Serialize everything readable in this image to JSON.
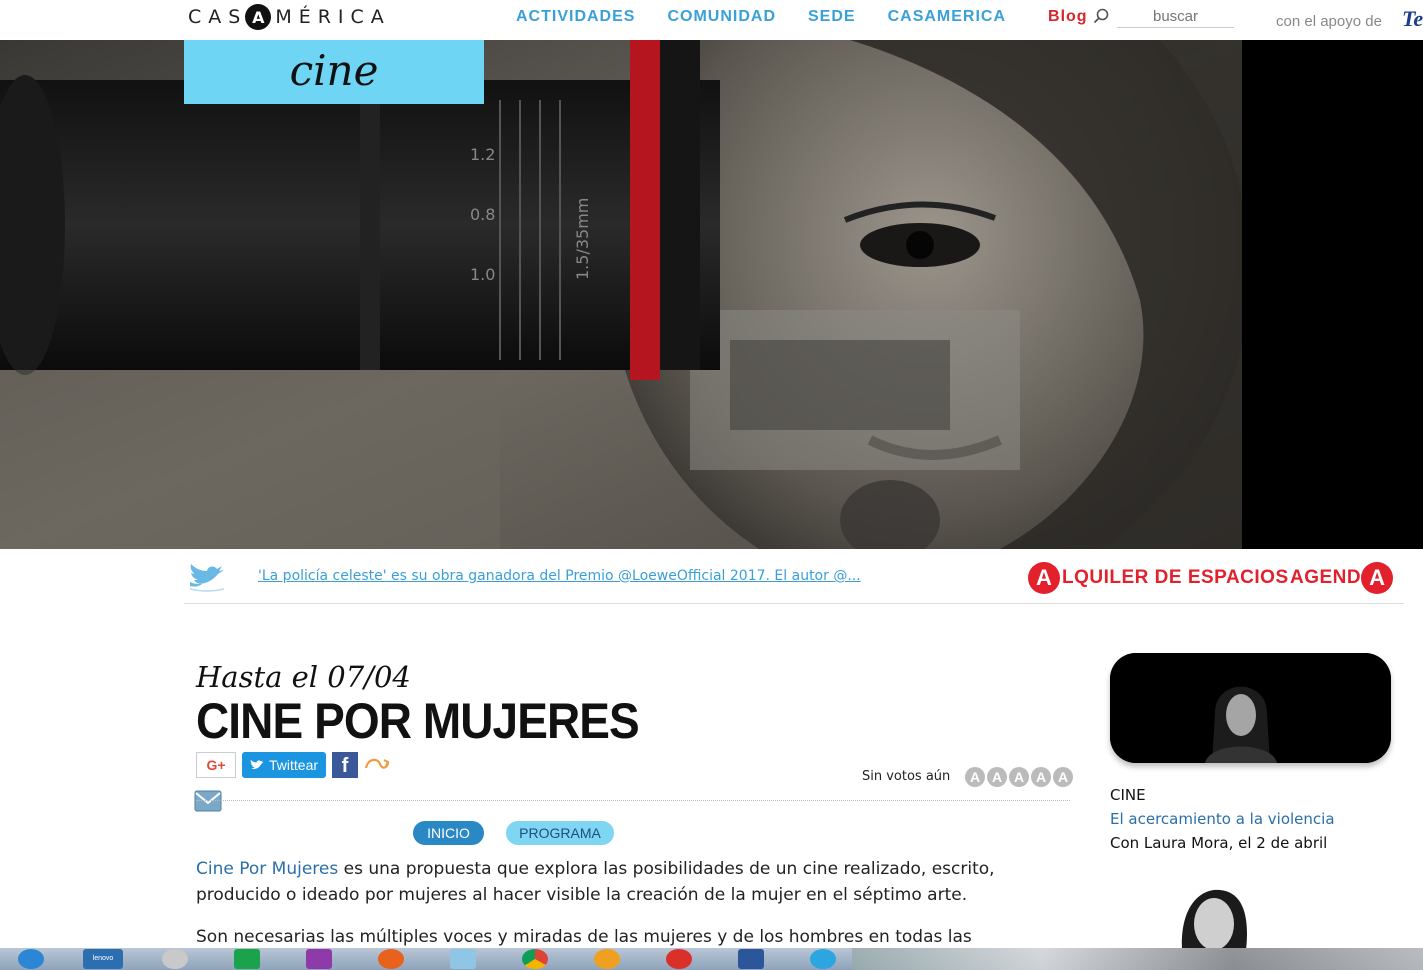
{
  "header": {
    "logo_left": "CAS",
    "logo_a": "A",
    "logo_right": "MÉRICA",
    "nav": [
      "ACTIVIDADES",
      "COMUNIDAD",
      "SEDE",
      "CASAMERICA"
    ],
    "blog": "Blog",
    "search_placeholder": "buscar",
    "support_text": "con el apoyo de",
    "sponsor_logo": "Te"
  },
  "hero": {
    "section_tag": "cine"
  },
  "twitter": {
    "tweet_text": "'La policía celeste' es su obra ganadora del Premio @LoeweOfficial 2017. El autor @...",
    "alquiler_a": "A",
    "alquiler_text": "LQUILER DE ESPACIOS",
    "agenda_text": "AGEND",
    "agenda_a": "A"
  },
  "article": {
    "date_line": "Hasta el 07/04",
    "title": "CINE POR MUJERES",
    "share": {
      "gplus": "G+",
      "tweet": "Twittear",
      "facebook": "f"
    },
    "votes_label": "Sin votos aún",
    "stars": [
      "A",
      "A",
      "A",
      "A",
      "A"
    ],
    "tabs": {
      "inicio": "INICIO",
      "programa": "PROGRAMA"
    },
    "para1_highlight": "Cine Por Mujeres",
    "para1_rest": " es una propuesta que explora las posibilidades de un cine realizado, escrito, producido o ideado por mujeres al hacer visible la creación de la mujer en el séptimo arte.",
    "para2": "Son necesarias las múltiples voces y miradas de las mujeres y de los hombres en todas las"
  },
  "sidebar": {
    "category": "CINE",
    "link": "El acercamiento a la violencia",
    "subtitle": "Con Laura Mora, el 2 de abril"
  },
  "taskbar": {
    "icons": [
      "ie-icon",
      "lenovo-icon",
      "camera-icon",
      "store-icon",
      "onenote-icon",
      "firefox-icon",
      "notepad-icon",
      "chrome-icon",
      "ship-icon",
      "mail-icon",
      "word-icon",
      "telegram-icon"
    ],
    "lenovo_label": "lenovo"
  },
  "colors": {
    "nav_blue": "#3aa0d8",
    "blog_red": "#d6282c",
    "cine_tag_bg": "#6fd5f5",
    "brand_red": "#e2212d",
    "link_blue": "#2a6fa8"
  }
}
